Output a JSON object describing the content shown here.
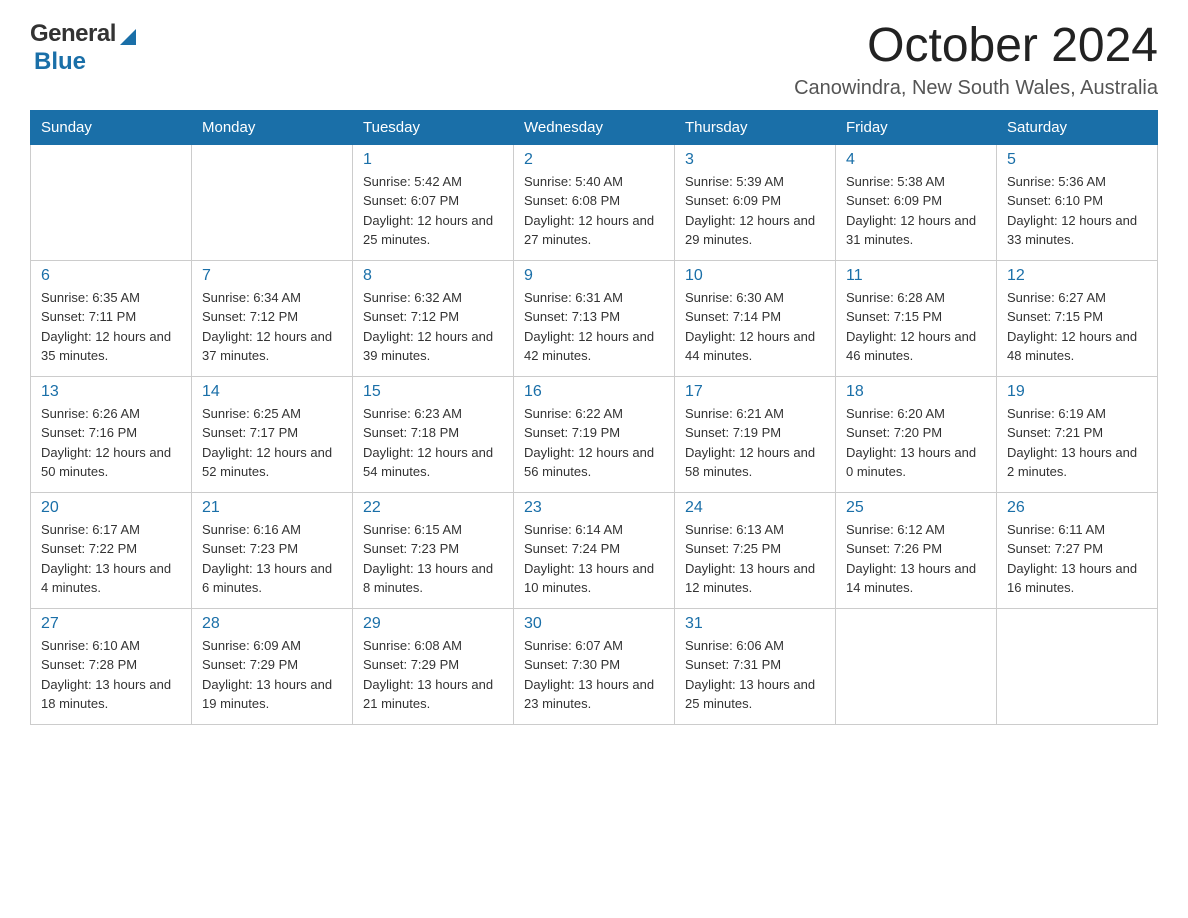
{
  "header": {
    "logo_general": "General",
    "logo_blue": "Blue",
    "month_title": "October 2024",
    "location": "Canowindra, New South Wales, Australia"
  },
  "days_of_week": [
    "Sunday",
    "Monday",
    "Tuesday",
    "Wednesday",
    "Thursday",
    "Friday",
    "Saturday"
  ],
  "weeks": [
    [
      {
        "day": "",
        "sunrise": "",
        "sunset": "",
        "daylight": ""
      },
      {
        "day": "",
        "sunrise": "",
        "sunset": "",
        "daylight": ""
      },
      {
        "day": "1",
        "sunrise": "Sunrise: 5:42 AM",
        "sunset": "Sunset: 6:07 PM",
        "daylight": "Daylight: 12 hours and 25 minutes."
      },
      {
        "day": "2",
        "sunrise": "Sunrise: 5:40 AM",
        "sunset": "Sunset: 6:08 PM",
        "daylight": "Daylight: 12 hours and 27 minutes."
      },
      {
        "day": "3",
        "sunrise": "Sunrise: 5:39 AM",
        "sunset": "Sunset: 6:09 PM",
        "daylight": "Daylight: 12 hours and 29 minutes."
      },
      {
        "day": "4",
        "sunrise": "Sunrise: 5:38 AM",
        "sunset": "Sunset: 6:09 PM",
        "daylight": "Daylight: 12 hours and 31 minutes."
      },
      {
        "day": "5",
        "sunrise": "Sunrise: 5:36 AM",
        "sunset": "Sunset: 6:10 PM",
        "daylight": "Daylight: 12 hours and 33 minutes."
      }
    ],
    [
      {
        "day": "6",
        "sunrise": "Sunrise: 6:35 AM",
        "sunset": "Sunset: 7:11 PM",
        "daylight": "Daylight: 12 hours and 35 minutes."
      },
      {
        "day": "7",
        "sunrise": "Sunrise: 6:34 AM",
        "sunset": "Sunset: 7:12 PM",
        "daylight": "Daylight: 12 hours and 37 minutes."
      },
      {
        "day": "8",
        "sunrise": "Sunrise: 6:32 AM",
        "sunset": "Sunset: 7:12 PM",
        "daylight": "Daylight: 12 hours and 39 minutes."
      },
      {
        "day": "9",
        "sunrise": "Sunrise: 6:31 AM",
        "sunset": "Sunset: 7:13 PM",
        "daylight": "Daylight: 12 hours and 42 minutes."
      },
      {
        "day": "10",
        "sunrise": "Sunrise: 6:30 AM",
        "sunset": "Sunset: 7:14 PM",
        "daylight": "Daylight: 12 hours and 44 minutes."
      },
      {
        "day": "11",
        "sunrise": "Sunrise: 6:28 AM",
        "sunset": "Sunset: 7:15 PM",
        "daylight": "Daylight: 12 hours and 46 minutes."
      },
      {
        "day": "12",
        "sunrise": "Sunrise: 6:27 AM",
        "sunset": "Sunset: 7:15 PM",
        "daylight": "Daylight: 12 hours and 48 minutes."
      }
    ],
    [
      {
        "day": "13",
        "sunrise": "Sunrise: 6:26 AM",
        "sunset": "Sunset: 7:16 PM",
        "daylight": "Daylight: 12 hours and 50 minutes."
      },
      {
        "day": "14",
        "sunrise": "Sunrise: 6:25 AM",
        "sunset": "Sunset: 7:17 PM",
        "daylight": "Daylight: 12 hours and 52 minutes."
      },
      {
        "day": "15",
        "sunrise": "Sunrise: 6:23 AM",
        "sunset": "Sunset: 7:18 PM",
        "daylight": "Daylight: 12 hours and 54 minutes."
      },
      {
        "day": "16",
        "sunrise": "Sunrise: 6:22 AM",
        "sunset": "Sunset: 7:19 PM",
        "daylight": "Daylight: 12 hours and 56 minutes."
      },
      {
        "day": "17",
        "sunrise": "Sunrise: 6:21 AM",
        "sunset": "Sunset: 7:19 PM",
        "daylight": "Daylight: 12 hours and 58 minutes."
      },
      {
        "day": "18",
        "sunrise": "Sunrise: 6:20 AM",
        "sunset": "Sunset: 7:20 PM",
        "daylight": "Daylight: 13 hours and 0 minutes."
      },
      {
        "day": "19",
        "sunrise": "Sunrise: 6:19 AM",
        "sunset": "Sunset: 7:21 PM",
        "daylight": "Daylight: 13 hours and 2 minutes."
      }
    ],
    [
      {
        "day": "20",
        "sunrise": "Sunrise: 6:17 AM",
        "sunset": "Sunset: 7:22 PM",
        "daylight": "Daylight: 13 hours and 4 minutes."
      },
      {
        "day": "21",
        "sunrise": "Sunrise: 6:16 AM",
        "sunset": "Sunset: 7:23 PM",
        "daylight": "Daylight: 13 hours and 6 minutes."
      },
      {
        "day": "22",
        "sunrise": "Sunrise: 6:15 AM",
        "sunset": "Sunset: 7:23 PM",
        "daylight": "Daylight: 13 hours and 8 minutes."
      },
      {
        "day": "23",
        "sunrise": "Sunrise: 6:14 AM",
        "sunset": "Sunset: 7:24 PM",
        "daylight": "Daylight: 13 hours and 10 minutes."
      },
      {
        "day": "24",
        "sunrise": "Sunrise: 6:13 AM",
        "sunset": "Sunset: 7:25 PM",
        "daylight": "Daylight: 13 hours and 12 minutes."
      },
      {
        "day": "25",
        "sunrise": "Sunrise: 6:12 AM",
        "sunset": "Sunset: 7:26 PM",
        "daylight": "Daylight: 13 hours and 14 minutes."
      },
      {
        "day": "26",
        "sunrise": "Sunrise: 6:11 AM",
        "sunset": "Sunset: 7:27 PM",
        "daylight": "Daylight: 13 hours and 16 minutes."
      }
    ],
    [
      {
        "day": "27",
        "sunrise": "Sunrise: 6:10 AM",
        "sunset": "Sunset: 7:28 PM",
        "daylight": "Daylight: 13 hours and 18 minutes."
      },
      {
        "day": "28",
        "sunrise": "Sunrise: 6:09 AM",
        "sunset": "Sunset: 7:29 PM",
        "daylight": "Daylight: 13 hours and 19 minutes."
      },
      {
        "day": "29",
        "sunrise": "Sunrise: 6:08 AM",
        "sunset": "Sunset: 7:29 PM",
        "daylight": "Daylight: 13 hours and 21 minutes."
      },
      {
        "day": "30",
        "sunrise": "Sunrise: 6:07 AM",
        "sunset": "Sunset: 7:30 PM",
        "daylight": "Daylight: 13 hours and 23 minutes."
      },
      {
        "day": "31",
        "sunrise": "Sunrise: 6:06 AM",
        "sunset": "Sunset: 7:31 PM",
        "daylight": "Daylight: 13 hours and 25 minutes."
      },
      {
        "day": "",
        "sunrise": "",
        "sunset": "",
        "daylight": ""
      },
      {
        "day": "",
        "sunrise": "",
        "sunset": "",
        "daylight": ""
      }
    ]
  ]
}
